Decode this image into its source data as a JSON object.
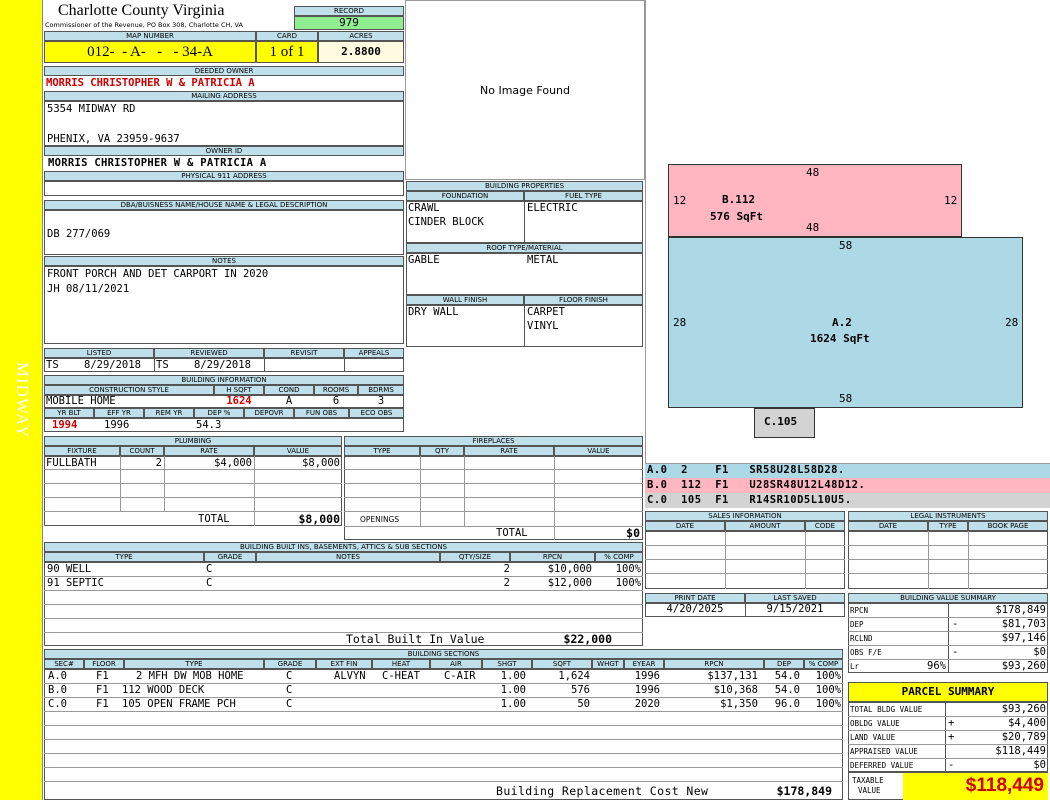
{
  "side_label": "MIDWAY",
  "county": {
    "name": "Charlotte County Virginia",
    "sub": "Commissioner of the Revenue, PO Box 308, Charlotte CH, VA"
  },
  "record": {
    "label": "RECORD",
    "value": "979"
  },
  "map": {
    "label": "MAP NUMBER",
    "value": "012-  - A-   -   - 34-A"
  },
  "card": {
    "label": "CARD",
    "value": "1 of 1"
  },
  "acres": {
    "label": "ACRES",
    "value": "2.8800"
  },
  "deeded_owner": {
    "label": "DEEDED OWNER",
    "value": "MORRIS CHRISTOPHER W & PATRICIA A"
  },
  "mailing": {
    "label": "MAILING ADDRESS",
    "line1": "5354 MIDWAY RD",
    "line2": "PHENIX, VA 23959-9637"
  },
  "owner_id": {
    "label": "OWNER ID",
    "value": "MORRIS CHRISTOPHER W & PATRICIA A"
  },
  "physical": {
    "label": "PHYSICAL 911 ADDRESS",
    "value": ""
  },
  "dba": {
    "label": "DBA/BUISNESS NAME/HOUSE NAME & LEGAL DESCRIPTION",
    "value": "DB 277/069"
  },
  "notes": {
    "label": "NOTES",
    "line1": "FRONT PORCH AND DET CARPORT IN 2020",
    "line2": "JH 08/11/2021"
  },
  "photo": {
    "text": "No Image Found"
  },
  "bprops": {
    "title": "BUILDING PROPERTIES",
    "foundation_label": "FOUNDATION",
    "fuel_label": "FUEL TYPE",
    "foundation1": "CRAWL",
    "foundation2": "CINDER BLOCK",
    "fuel": "ELECTRIC",
    "roof_label": "ROOF TYPE/MATERIAL",
    "roof_type": "GABLE",
    "roof_mat": "METAL",
    "wall_label": "WALL FINISH",
    "floor_label": "FLOOR FINISH",
    "wall": "DRY WALL",
    "floor1": "CARPET",
    "floor2": "VINYL"
  },
  "listing": {
    "listed_label": "LISTED",
    "reviewed_label": "REVIEWED",
    "revisit_label": "REVISIT",
    "appeals_label": "APPEALS",
    "listed_by": "TS",
    "listed_date": "8/29/2018",
    "reviewed_by": "TS",
    "reviewed_date": "8/29/2018"
  },
  "binfo": {
    "title": "BUILDING INFORMATION",
    "style_label": "CONSTRUCTION STYLE",
    "hsqft_label": "H SQFT",
    "cond_label": "COND",
    "rooms_label": "ROOMS",
    "bdrms_label": "BDRMS",
    "style": "MOBILE HOME",
    "hsqft": "1624",
    "cond": "A",
    "rooms": "6",
    "bdrms": "3",
    "yrblt_label": "YR BLT",
    "effyr_label": "EFF YR",
    "remyr_label": "REM YR",
    "dep_label": "DEP %",
    "depovr_label": "DEPOVR",
    "funobs_label": "FUN OBS",
    "ecoobs_label": "ECO OBS",
    "yrblt": "1994",
    "effyr": "1996",
    "dep": "54.3"
  },
  "plumbing": {
    "title": "PLUMBING",
    "h_fixture": "FIXTURE",
    "h_count": "COUNT",
    "h_rate": "RATE",
    "h_value": "VALUE",
    "fixture": "FULLBATH",
    "count": "2",
    "rate": "$4,000",
    "value": "$8,000",
    "total_label": "TOTAL",
    "total": "$8,000"
  },
  "fireplaces": {
    "title": "FIREPLACES",
    "h_type": "TYPE",
    "h_qty": "QTY",
    "h_rate": "RATE",
    "h_value": "VALUE",
    "openings_label": "OPENINGS",
    "total_label": "TOTAL",
    "total": "$0"
  },
  "builtins": {
    "title": "BUILDING BUILT INS, BASEMENTS, ATTICS & SUB SECTIONS",
    "h_type": "TYPE",
    "h_grade": "GRADE",
    "h_notes": "NOTES",
    "h_qty": "QTY/SIZE",
    "h_rpcn": "RPCN",
    "h_comp": "% COMP",
    "rows": [
      {
        "type": "90 WELL",
        "grade": "C",
        "qty": "2",
        "rpcn": "$10,000",
        "comp": "100%"
      },
      {
        "type": "91 SEPTIC",
        "grade": "C",
        "qty": "2",
        "rpcn": "$12,000",
        "comp": "100%"
      }
    ],
    "total_label": "Total Built In Value",
    "total": "$22,000"
  },
  "sections": {
    "title": "BUILDING SECTIONS",
    "h_sec": "SEC#",
    "h_floor": "FLOOR",
    "h_type": "TYPE",
    "h_grade": "GRADE",
    "h_extfin": "EXT FIN",
    "h_heat": "HEAT",
    "h_air": "AIR",
    "h_shgt": "SHGT",
    "h_sqft": "SQFT",
    "h_whgt": "WHGT",
    "h_eyear": "EYEAR",
    "h_rpcn": "RPCN",
    "h_dep": "DEP",
    "h_comp": "% COMP",
    "rows": [
      {
        "sec": "A.0",
        "floor": "F1",
        "type": "2 MFH DW MOB HOME",
        "grade": "C",
        "extfin": "ALVYN",
        "heat": "C-HEAT",
        "air": "C-AIR",
        "shgt": "1.00",
        "sqft": "1,624",
        "eyear": "1996",
        "rpcn": "$137,131",
        "dep": "54.0",
        "comp": "100%"
      },
      {
        "sec": "B.0",
        "floor": "F1",
        "type": "112 WOOD DECK",
        "grade": "C",
        "extfin": "",
        "heat": "",
        "air": "",
        "shgt": "1.00",
        "sqft": "576",
        "eyear": "1996",
        "rpcn": "$10,368",
        "dep": "54.0",
        "comp": "100%"
      },
      {
        "sec": "C.0",
        "floor": "F1",
        "type": "105 OPEN FRAME PCH",
        "grade": "C",
        "extfin": "",
        "heat": "",
        "air": "",
        "shgt": "1.00",
        "sqft": "50",
        "eyear": "2020",
        "rpcn": "$1,350",
        "dep": "96.0",
        "comp": "100%"
      }
    ],
    "total_label": "Building Replacement Cost New",
    "total": "$178,849"
  },
  "sketch": {
    "b_name": "B.112",
    "b_area": "576 SqFt",
    "b_top": "48",
    "b_bottom": "48",
    "b_left": "12",
    "b_right": "12",
    "a_name": "A.2",
    "a_area": "1624 SqFt",
    "a_top": "58",
    "a_bottom": "58",
    "a_left": "28",
    "a_right": "28",
    "c_name": "C.105",
    "colors": {
      "a": "#add8e6",
      "b": "#ffb6c1",
      "c": "#d3d3d3"
    }
  },
  "legend": [
    {
      "text": "A.0  2    F1   SR58U28L58D28."
    },
    {
      "text": "B.0  112  F1   U28SR48U12L48D12."
    },
    {
      "text": "C.0  105  F1   R14SR10D5L10U5."
    }
  ],
  "sales": {
    "title": "SALES INFORMATION",
    "h_date": "DATE",
    "h_amount": "AMOUNT",
    "h_code": "CODE"
  },
  "legal": {
    "title": "LEGAL INSTRUMENTS",
    "h_date": "DATE",
    "h_type": "TYPE",
    "h_bookpage": "BOOK PAGE"
  },
  "dates": {
    "print_label": "PRINT DATE",
    "saved_label": "LAST SAVED",
    "print": "4/20/2025",
    "saved": "9/15/2021"
  },
  "bvs": {
    "title": "BUILDING VALUE SUMMARY",
    "rows": [
      {
        "label": "RPCN",
        "sign": "",
        "pct": "",
        "value": "$178,849"
      },
      {
        "label": "DEP",
        "sign": "-",
        "pct": "",
        "value": "$81,703"
      },
      {
        "label": "RCLND",
        "sign": "",
        "pct": "",
        "value": "$97,146"
      },
      {
        "label": "OBS F/E",
        "sign": "-",
        "pct": "",
        "value": "$0"
      },
      {
        "label": "Lr",
        "sign": "",
        "pct": "96%",
        "value": "$93,260"
      }
    ]
  },
  "parcel": {
    "title": "PARCEL SUMMARY",
    "rows": [
      {
        "label": "TOTAL BLDG VALUE",
        "sign": "",
        "value": "$93,260"
      },
      {
        "label": "OBLDG VALUE",
        "sign": "+",
        "value": "$4,400"
      },
      {
        "label": "LAND VALUE",
        "sign": "+",
        "value": "$20,789"
      },
      {
        "label": "APPRAISED VALUE",
        "sign": "",
        "value": "$118,449"
      },
      {
        "label": "DEFERRED VALUE",
        "sign": "-",
        "value": "$0"
      }
    ],
    "taxable_label1": "TAXABLE",
    "taxable_label2": "VALUE",
    "taxable": "$118,449"
  }
}
